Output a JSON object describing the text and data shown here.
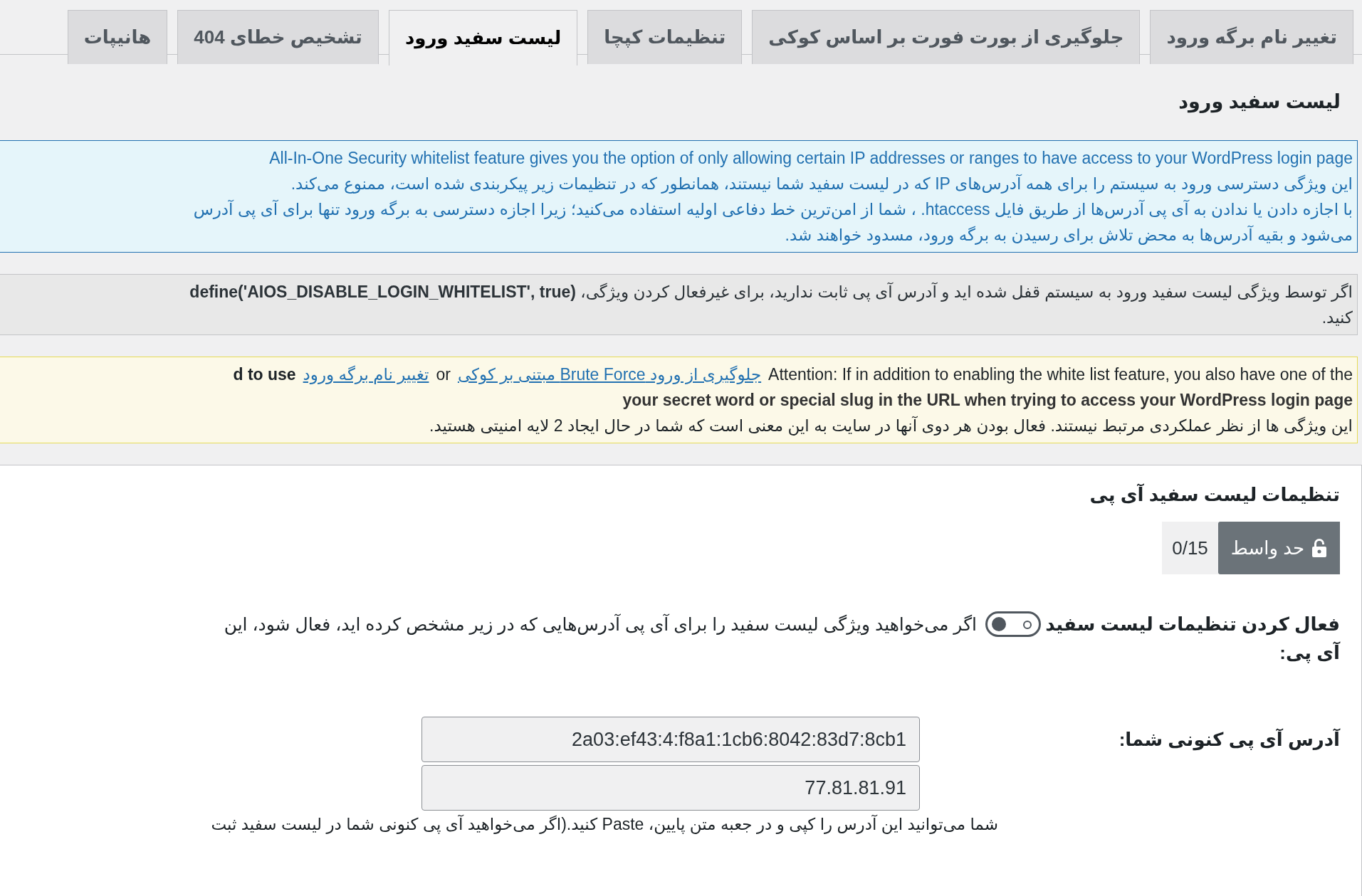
{
  "tabs": [
    {
      "label": "تغییر نام برگه ورود",
      "selected": false
    },
    {
      "label": "جلوگیری از بورت فورت بر اساس کوکی",
      "selected": false
    },
    {
      "label": "تنظیمات کپچا",
      "selected": false
    },
    {
      "label": "لیست سفید ورود",
      "selected": true
    },
    {
      "label": "تشخیص خطای 404",
      "selected": false
    },
    {
      "label": "هانیپات",
      "selected": false
    }
  ],
  "page_title": "لیست سفید ورود",
  "info_box": {
    "lines": [
      "All-In-One Security whitelist feature gives you the option of only allowing certain IP addresses or ranges to have access to your WordPress login page",
      "این ویژگی دسترسی ورود به سیستم را برای همه آدرس‌های IP که در لیست سفید شما نیستند، همانطور که در تنظیمات زیر پیکربندی شده است، ممنوع می‌کند.",
      "با اجازه دادن یا ندادن به آی پی آدرس‌ها از طریق فایل htaccess. ، شما از امن‌ترین خط دفاعی اولیه استفاده می‌کنید؛ زیرا اجازه دسترسی به برگه ورود تنها برای آی پی آدرس",
      "می‌شود و بقیه آدرس‌ها به محض تلاش برای رسیدن به برگه ورود، مسدود خواهند شد."
    ]
  },
  "notice_box": {
    "lines": [
      "اگر توسط ویژگی لیست سفید ورود به سیستم قفل شده اید و آدرس آی پی ثابت ندارید، برای غیرفعال کردن ویژگی، **define('AIOS_DISABLE_LOGIN_WHITELIST', true)**",
      "کنید."
    ]
  },
  "warning_box": {
    "first_line": [
      {
        "kind": "text",
        "text": "Attention: If in addition to enabling the white list feature, you also have one of the"
      },
      {
        "kind": "link",
        "text": "جلوگیری از ورود Brute Force مبتنی بر کوکی"
      },
      {
        "kind": "text",
        "text": "or"
      },
      {
        "kind": "link",
        "text": "تغییر نام برگه ورود"
      },
      {
        "kind": "bold",
        "text": "d to use"
      }
    ],
    "second_line": "your secret word or special slug in the URL when trying to access your WordPress login page",
    "third_line": "این ویژگی ها از نظر عملکردی مرتبط نیستند. فعال بودن هر دوی آنها در سایت به این معنی است که شما در حال ایجاد 2 لایه امنیتی هستید."
  },
  "settings_panel": {
    "title": "تنظیمات لیست سفید آی پی",
    "badge": {
      "label": "حد واسط",
      "count": "0/15"
    },
    "fields": [
      {
        "kind": "toggle",
        "label": "فعال کردن تنظیمات لیست سفید آی پی:",
        "on": false,
        "description": "اگر می‌خواهید ویژگی لیست سفید را برای آی پی آدرس‌هایی که در زیر مشخص کرده اید، فعال شود، این"
      },
      {
        "kind": "ip",
        "label": "آدرس آی پی کنونی شما:",
        "values": [
          "2a03:ef43:4:f8a1:1cb6:8042:83d7:8cb1",
          "77.81.81.91"
        ]
      }
    ],
    "footnote": "شما می‌توانید این آدرس را کپی و در جعبه متن پایین، Paste کنید.(اگر می‌خواهید آی پی کنونی شما در لیست سفید ثبت"
  }
}
